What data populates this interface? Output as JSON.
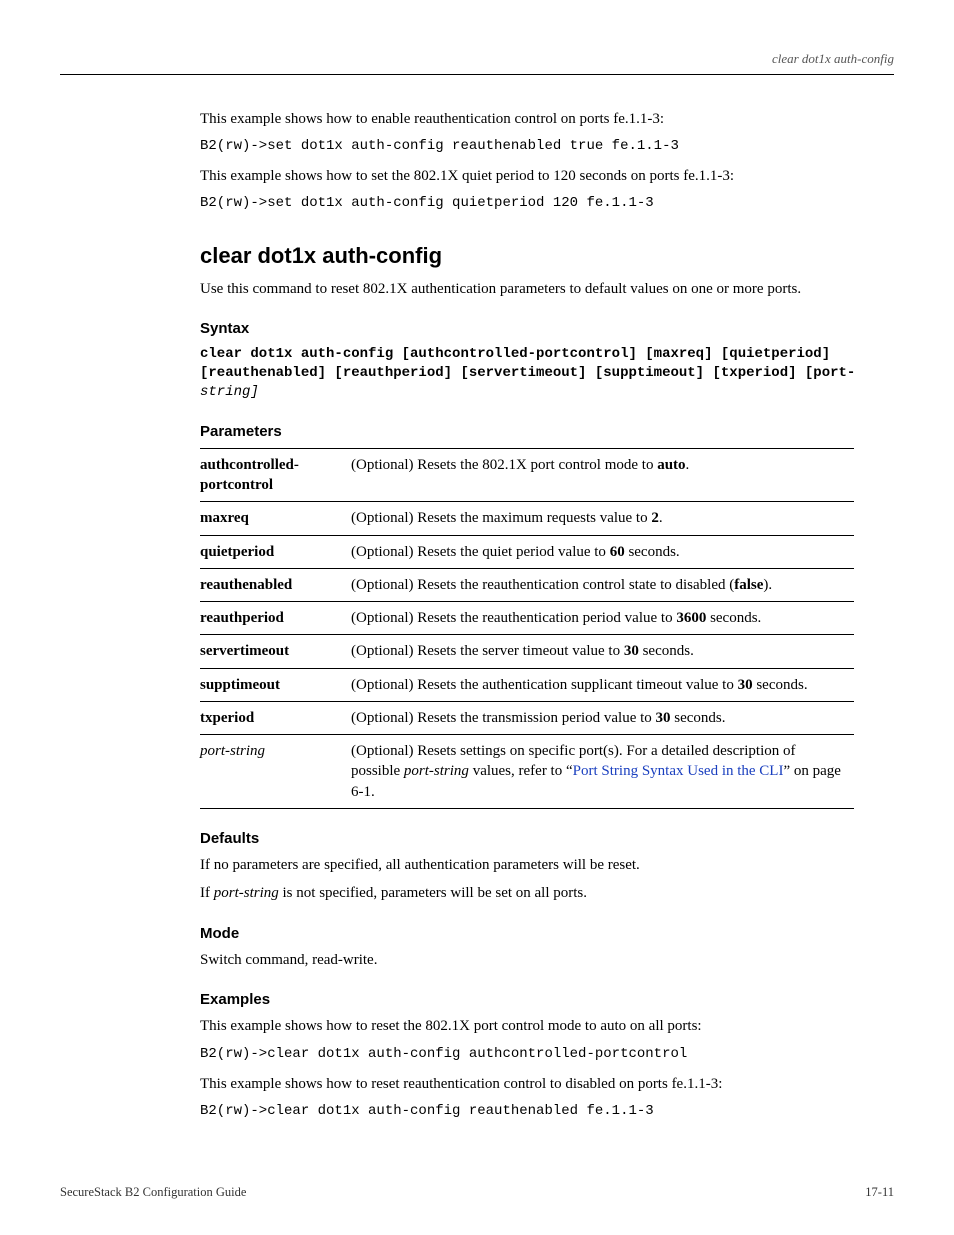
{
  "runningHead": "clear dot1x auth-config",
  "intro": {
    "ex2_text": "This example shows how to enable reauthentication control on ports fe.1.1-3:",
    "ex2_code": "B2(rw)->set dot1x auth-config reauthenabled true fe.1.1-3",
    "ex3_text": "This example shows how to set the 802.1X quiet period to 120 seconds on ports fe.1.1-3:",
    "ex3_code": "B2(rw)->set dot1x auth-config quietperiod 120 fe.1.1-3"
  },
  "command": {
    "title": "clear dot1x auth-config",
    "desc": "Use this command to reset 802.1X authentication parameters to default values on one or more ports."
  },
  "syntax": {
    "heading": "Syntax",
    "code_l1": "clear dot1x auth-config [authcontrolled-portcontrol] [maxreq] [quietperiod]",
    "code_l2": "[reauthenabled] [reauthperiod] [servertimeout] [supptimeout] [txperiod] [port-",
    "code_l3": "string]"
  },
  "paramsHeading": "Parameters",
  "params": [
    {
      "name": "authcontrolled-portcontrol",
      "italic": false,
      "desc_pre": "(Optional) Resets the 802.1X port control mode to ",
      "bold": "auto",
      "desc_post": "."
    },
    {
      "name": "maxreq",
      "italic": false,
      "desc_pre": "(Optional) Resets the maximum requests value to ",
      "bold": "2",
      "desc_post": "."
    },
    {
      "name": "quietperiod",
      "italic": false,
      "desc_pre": "(Optional) Resets the quiet period value to ",
      "bold": "60",
      "desc_post": " seconds."
    },
    {
      "name": "reauthenabled",
      "italic": false,
      "desc_pre": "(Optional) Resets the reauthentication control state to disabled (",
      "bold": "false",
      "desc_post": ")."
    },
    {
      "name": "reauthperiod",
      "italic": false,
      "desc_pre": "(Optional) Resets the reauthentication period value to ",
      "bold": "3600",
      "desc_post": " seconds."
    },
    {
      "name": "servertimeout",
      "italic": false,
      "desc_pre": "(Optional) Resets the server timeout value to ",
      "bold": "30",
      "desc_post": " seconds."
    },
    {
      "name": "supptimeout",
      "italic": false,
      "desc_pre": "(Optional) Resets the authentication supplicant timeout value to ",
      "bold": "30",
      "desc_post": " seconds."
    },
    {
      "name": "txperiod",
      "italic": false,
      "desc_pre": "(Optional) Resets the transmission period value to ",
      "bold": "30",
      "desc_post": " seconds."
    },
    {
      "name": "port-string",
      "italic": true,
      "desc_pre": "(Optional) Resets settings on specific port(s). For a detailed description of possible ",
      "italic_inline": "port-string",
      "desc_mid": " values, refer to “",
      "link": "Port String Syntax Used in the CLI",
      "desc_post": "” on page 6-1."
    }
  ],
  "defaults": {
    "heading": "Defaults",
    "line1": "If no parameters are specified, all authentication parameters will be reset.",
    "line2_pre": "If ",
    "line2_italic": "port-string",
    "line2_post": " is not specified, parameters will be set on all ports."
  },
  "mode": {
    "heading": "Mode",
    "text": "Switch command, read-write."
  },
  "examples": {
    "heading": "Examples",
    "ex1_text": "This example shows how to reset the 802.1X port control mode to auto on all ports:",
    "ex1_code": "B2(rw)->clear dot1x auth-config authcontrolled-portcontrol",
    "ex2_text": "This example shows how to reset reauthentication control to disabled on ports fe.1.1-3:",
    "ex2_code": "B2(rw)->clear dot1x auth-config reauthenabled fe.1.1-3"
  },
  "footer": {
    "left": "SecureStack B2 Configuration Guide",
    "right": "17-11"
  }
}
